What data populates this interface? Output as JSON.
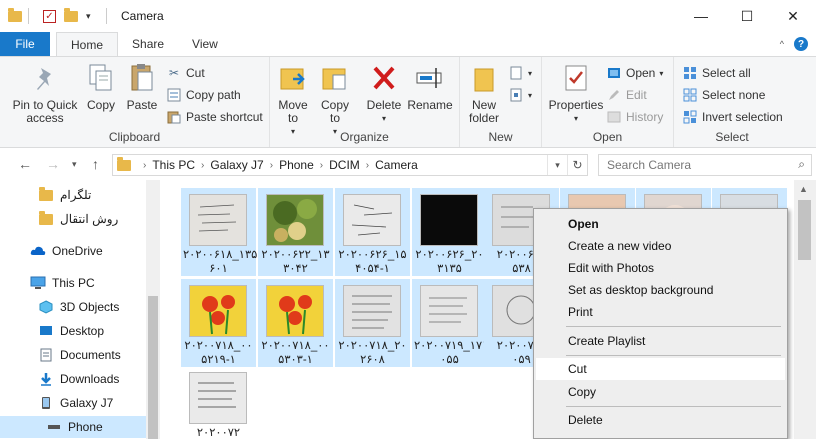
{
  "window": {
    "title": "Camera",
    "controls": {
      "minimize": "—",
      "maximize": "☐",
      "close": "✕"
    }
  },
  "tabs": {
    "file": "File",
    "home": "Home",
    "share": "Share",
    "view": "View"
  },
  "ribbon": {
    "clipboard": {
      "label": "Clipboard",
      "pin": "Pin to Quick access",
      "copy": "Copy",
      "paste": "Paste",
      "cut": "Cut",
      "copy_path": "Copy path",
      "paste_shortcut": "Paste shortcut"
    },
    "organize": {
      "label": "Organize",
      "move_to": "Move to",
      "copy_to": "Copy to",
      "delete": "Delete",
      "rename": "Rename"
    },
    "new": {
      "label": "New",
      "new_folder": "New folder"
    },
    "open": {
      "label": "Open",
      "properties": "Properties",
      "open": "Open",
      "edit": "Edit",
      "history": "History"
    },
    "select": {
      "label": "Select",
      "select_all": "Select all",
      "select_none": "Select none",
      "invert": "Invert selection"
    }
  },
  "address": {
    "crumbs": [
      "This PC",
      "Galaxy J7",
      "Phone",
      "DCIM",
      "Camera"
    ],
    "search_placeholder": "Search Camera"
  },
  "sidebar": {
    "items": [
      {
        "label": "تلگرام"
      },
      {
        "label": "روش انتقال"
      },
      {
        "label": "OneDrive"
      },
      {
        "label": "This PC"
      },
      {
        "label": "3D Objects"
      },
      {
        "label": "Desktop"
      },
      {
        "label": "Documents"
      },
      {
        "label": "Downloads"
      },
      {
        "label": "Galaxy J7"
      },
      {
        "label": "Phone"
      }
    ]
  },
  "files": [
    {
      "line1": "۲۰۲۰۰۶۱۸_۱۳۵",
      "line2": "۶۰۱"
    },
    {
      "line1": "۲۰۲۰۰۶۲۲_۱۳",
      "line2": "۳۰۴۲"
    },
    {
      "line1": "۲۰۲۰۰۶۲۶_۱۵",
      "line2": "۴۰۵۴-۱"
    },
    {
      "line1": "۲۰۲۰۰۶۲۶_۲۰",
      "line2": "۳۱۳۵"
    },
    {
      "line1": "۲۰۲۰۰۶۲۸",
      "line2": "۵۳۸"
    },
    {
      "line1": "",
      "line2": ""
    },
    {
      "line1": "",
      "line2": ""
    },
    {
      "line1": "",
      "line2": ""
    },
    {
      "line1": "۲۰۲۰۰۷۱۸_۰۰",
      "line2": "۵۲۱۹-۱"
    },
    {
      "line1": "۲۰۲۰۰۷۱۸_۰۰",
      "line2": "۵۳۰۳-۱"
    },
    {
      "line1": "۲۰۲۰۰۷۱۸_۲۰",
      "line2": "۲۶۰۸"
    },
    {
      "line1": "۲۰۲۰۰۷۱۹_۱۷۱",
      "line2": "۰۵۵"
    },
    {
      "line1": "۲۰۲۰۰۷۱۹",
      "line2": "۰۵۹"
    },
    {
      "line1": "۲۰۲۰۰۷۲",
      "line2": ""
    }
  ],
  "context_menu": {
    "open": "Open",
    "create_video": "Create a new video",
    "edit_photos": "Edit with Photos",
    "set_desktop": "Set as desktop background",
    "print": "Print",
    "create_playlist": "Create Playlist",
    "cut": "Cut",
    "copy": "Copy",
    "delete": "Delete"
  }
}
